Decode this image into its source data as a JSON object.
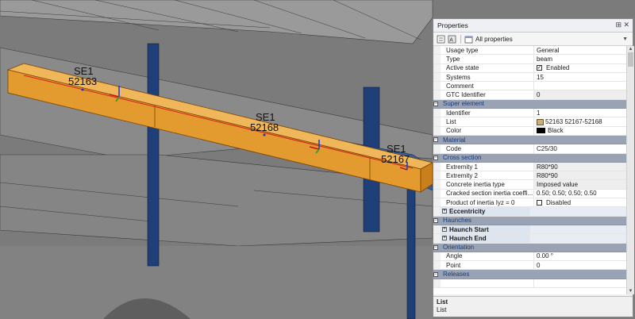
{
  "viewport": {
    "labels": [
      {
        "prefix": "SE1",
        "id": "52163"
      },
      {
        "prefix": "SE1",
        "id": "52168"
      },
      {
        "prefix": "SE1",
        "id": "52167"
      }
    ],
    "colors": {
      "beam_fill": "#e8a23a",
      "beam_edge": "#8a4d00",
      "column": "#1f3f78",
      "slab": "#8c8c8c",
      "background": "#7b7b7b"
    }
  },
  "panel": {
    "title": "Properties",
    "title_icons": [
      "pin-icon",
      "close-icon"
    ],
    "toolbar": {
      "filter_value": "All properties"
    },
    "rows": [
      {
        "kind": "prop",
        "name": "Usage type",
        "value": "General"
      },
      {
        "kind": "prop",
        "name": "Type",
        "value": "beam"
      },
      {
        "kind": "check",
        "name": "Active state",
        "value": "Enabled",
        "checked": true
      },
      {
        "kind": "prop",
        "name": "Systems",
        "value": "15"
      },
      {
        "kind": "prop",
        "name": "Comment",
        "value": ""
      },
      {
        "kind": "prop",
        "name": "GTC Identifier",
        "value": "0",
        "grey": true
      },
      {
        "kind": "group",
        "name": "Super element"
      },
      {
        "kind": "prop",
        "name": "Identifier",
        "value": "1"
      },
      {
        "kind": "list",
        "name": "List",
        "value": "52163 52167-52168"
      },
      {
        "kind": "color",
        "name": "Color",
        "value": "Black",
        "swatch": "#000000"
      },
      {
        "kind": "group",
        "name": "Material"
      },
      {
        "kind": "prop",
        "name": "Code",
        "value": "C25/30"
      },
      {
        "kind": "group",
        "name": "Cross section"
      },
      {
        "kind": "prop",
        "name": "Extremity 1",
        "value": "R80*90",
        "grey": true
      },
      {
        "kind": "prop",
        "name": "Extremity 2",
        "value": "R80*90",
        "grey": true
      },
      {
        "kind": "prop",
        "name": "Concrete inertia type",
        "value": "Imposed value",
        "grey": true
      },
      {
        "kind": "prop",
        "name": "Cracked section inertia coeffi...",
        "value": "0.50; 0.50; 0.50; 0.50"
      },
      {
        "kind": "check",
        "name": "Product of inertia Iyz = 0",
        "value": "Disabled",
        "checked": false
      },
      {
        "kind": "sub",
        "name": "Eccentricity",
        "value": ""
      },
      {
        "kind": "group",
        "name": "Haunches"
      },
      {
        "kind": "sub",
        "name": "Haunch Start",
        "value": ""
      },
      {
        "kind": "sub",
        "name": "Haunch End",
        "value": ""
      },
      {
        "kind": "group",
        "name": "Orientation"
      },
      {
        "kind": "prop",
        "name": "Angle",
        "value": "0.00 °"
      },
      {
        "kind": "prop",
        "name": "Point",
        "value": "0"
      },
      {
        "kind": "group",
        "name": "Releases"
      },
      {
        "kind": "prop",
        "name": "",
        "value": ""
      }
    ],
    "description": {
      "title": "List",
      "text": "List"
    }
  }
}
